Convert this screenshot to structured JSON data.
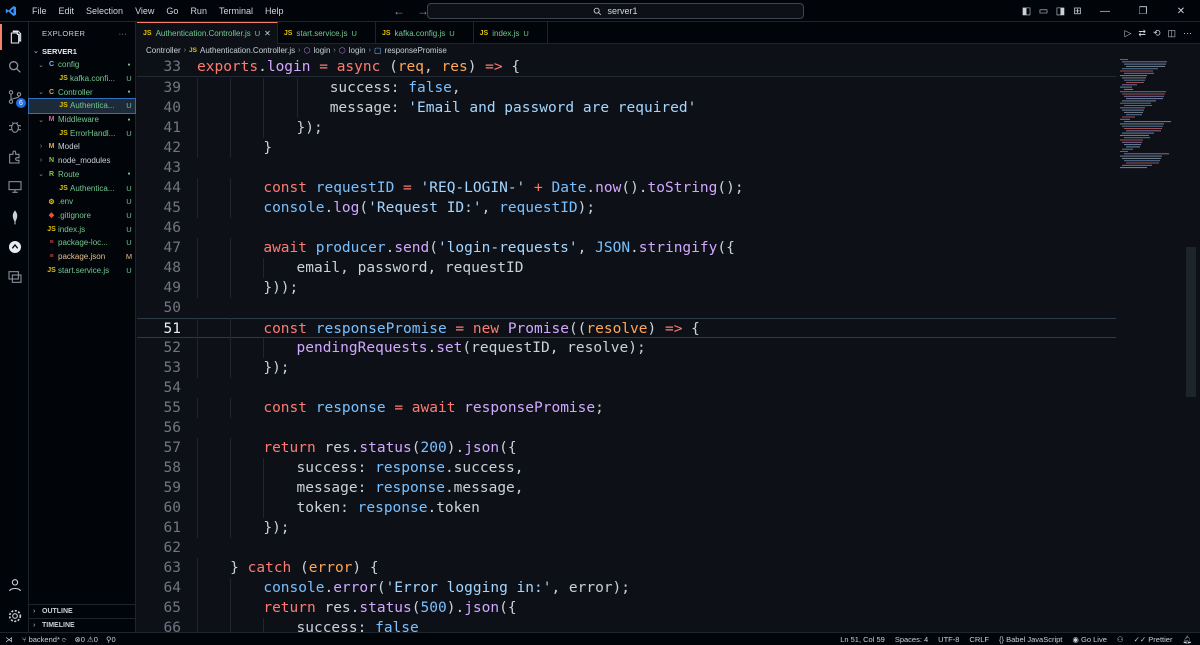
{
  "menu": [
    "File",
    "Edit",
    "Selection",
    "View",
    "Go",
    "Run",
    "Terminal",
    "Help"
  ],
  "search": {
    "label": "server1"
  },
  "sidebar": {
    "title": "EXPLORER",
    "more": "···",
    "root": "SERVER1",
    "items": [
      {
        "name": "config",
        "type": "folder",
        "open": true,
        "depth": 1,
        "icon": "C",
        "icon_color": "#7fb5ff",
        "status": "●",
        "status_color": "#73c991",
        "name_color": "#73c991"
      },
      {
        "name": "kafka.confi...",
        "type": "file",
        "depth": 2,
        "icon": "JS",
        "icon_color": "#e3c200",
        "status": "U",
        "status_color": "#73c991",
        "name_color": "#73c991"
      },
      {
        "name": "Controller",
        "type": "folder",
        "open": true,
        "depth": 1,
        "icon": "C",
        "icon_color": "#e8a34d",
        "status": "●",
        "status_color": "#73c991",
        "name_color": "#73c991"
      },
      {
        "name": "Authentica...",
        "type": "file",
        "depth": 2,
        "icon": "JS",
        "icon_color": "#e3c200",
        "status": "U",
        "status_color": "#73c991",
        "name_color": "#73c991",
        "selected": true
      },
      {
        "name": "Middleware",
        "type": "folder",
        "open": true,
        "depth": 1,
        "icon": "M",
        "icon_color": "#e55a9b",
        "status": "●",
        "status_color": "#73c991",
        "name_color": "#73c991"
      },
      {
        "name": "ErrorHandl...",
        "type": "file",
        "depth": 2,
        "icon": "JS",
        "icon_color": "#e3c200",
        "status": "U",
        "status_color": "#73c991",
        "name_color": "#73c991"
      },
      {
        "name": "Model",
        "type": "folder",
        "open": false,
        "depth": 1,
        "icon": "M",
        "icon_color": "#e8a34d",
        "status": "",
        "status_color": "#73c991",
        "name_color": "#c9d1d9"
      },
      {
        "name": "node_modules",
        "type": "folder",
        "open": false,
        "depth": 1,
        "icon": "N",
        "icon_color": "#8bc34a",
        "status": "",
        "status_color": "#73c991",
        "name_color": "#c9d1d9"
      },
      {
        "name": "Route",
        "type": "folder",
        "open": true,
        "depth": 1,
        "icon": "R",
        "icon_color": "#8bc34a",
        "status": "●",
        "status_color": "#73c991",
        "name_color": "#73c991"
      },
      {
        "name": "Authentica...",
        "type": "file",
        "depth": 2,
        "icon": "JS",
        "icon_color": "#e3c200",
        "status": "U",
        "status_color": "#73c991",
        "name_color": "#73c991"
      },
      {
        "name": ".env",
        "type": "file",
        "depth": 1,
        "icon": "⚙",
        "icon_color": "#e3c200",
        "status": "U",
        "status_color": "#73c991",
        "name_color": "#73c991"
      },
      {
        "name": ".gitignore",
        "type": "file",
        "depth": 1,
        "icon": "◆",
        "icon_color": "#f05133",
        "status": "U",
        "status_color": "#73c991",
        "name_color": "#73c991"
      },
      {
        "name": "index.js",
        "type": "file",
        "depth": 1,
        "icon": "JS",
        "icon_color": "#e3c200",
        "status": "U",
        "status_color": "#73c991",
        "name_color": "#73c991"
      },
      {
        "name": "package-loc...",
        "type": "file",
        "depth": 1,
        "icon": "≡",
        "icon_color": "#e5534b",
        "status": "U",
        "status_color": "#73c991",
        "name_color": "#73c991"
      },
      {
        "name": "package.json",
        "type": "file",
        "depth": 1,
        "icon": "≡",
        "icon_color": "#e5534b",
        "status": "M",
        "status_color": "#e2c08d",
        "name_color": "#e2c08d"
      },
      {
        "name": "start.service.js",
        "type": "file",
        "depth": 1,
        "icon": "JS",
        "icon_color": "#e3c200",
        "status": "U",
        "status_color": "#73c991",
        "name_color": "#73c991"
      }
    ],
    "outline": "OUTLINE",
    "timeline": "TIMELINE"
  },
  "tabs": [
    {
      "label": "Authentication.Controller.js",
      "mark": "U",
      "active": true,
      "close": "✕"
    },
    {
      "label": "start.service.js",
      "mark": "U",
      "active": false
    },
    {
      "label": "kafka.config.js",
      "mark": "U",
      "active": false
    },
    {
      "label": "index.js",
      "mark": "U",
      "active": false
    }
  ],
  "breadcrumb": [
    "Controller",
    "Authentication.Controller.js",
    "login",
    "login",
    "responsePromise"
  ],
  "editor": {
    "current_line": 51,
    "sticky_line": 33,
    "lines": [
      {
        "n": 33,
        "indent": 0,
        "t": [
          [
            "kw",
            "exports"
          ],
          [
            "pl",
            "."
          ],
          [
            "fn",
            "login"
          ],
          [
            "pl",
            " "
          ],
          [
            "kw",
            "="
          ],
          [
            "pl",
            " "
          ],
          [
            "kw",
            "async"
          ],
          [
            "pl",
            " ("
          ],
          [
            "var",
            "req"
          ],
          [
            "pl",
            ", "
          ],
          [
            "var",
            "res"
          ],
          [
            "pl",
            ") "
          ],
          [
            "kw",
            "=>"
          ],
          [
            "pl",
            " {"
          ]
        ]
      },
      {
        "n": 39,
        "indent": 4,
        "t": [
          [
            "pl",
            "success: "
          ],
          [
            "con",
            "false"
          ],
          [
            "pl",
            ","
          ]
        ]
      },
      {
        "n": 40,
        "indent": 4,
        "t": [
          [
            "pl",
            "message: "
          ],
          [
            "str",
            "'Email and password are required'"
          ]
        ]
      },
      {
        "n": 41,
        "indent": 3,
        "t": [
          [
            "pl",
            "});"
          ]
        ]
      },
      {
        "n": 42,
        "indent": 2,
        "t": [
          [
            "pl",
            "}"
          ]
        ]
      },
      {
        "n": 43,
        "indent": 0,
        "t": []
      },
      {
        "n": 44,
        "indent": 2,
        "t": [
          [
            "kw",
            "const"
          ],
          [
            "pl",
            " "
          ],
          [
            "con",
            "requestID"
          ],
          [
            "pl",
            " "
          ],
          [
            "kw",
            "="
          ],
          [
            "pl",
            " "
          ],
          [
            "str",
            "'REQ-LOGIN-'"
          ],
          [
            "pl",
            " "
          ],
          [
            "kw",
            "+"
          ],
          [
            "pl",
            " "
          ],
          [
            "con",
            "Date"
          ],
          [
            "pl",
            "."
          ],
          [
            "fn",
            "now"
          ],
          [
            "pl",
            "()."
          ],
          [
            "fn",
            "toString"
          ],
          [
            "pl",
            "();"
          ]
        ]
      },
      {
        "n": 45,
        "indent": 2,
        "t": [
          [
            "con",
            "console"
          ],
          [
            "pl",
            "."
          ],
          [
            "fn",
            "log"
          ],
          [
            "pl",
            "("
          ],
          [
            "str",
            "'Request ID:'"
          ],
          [
            "pl",
            ", "
          ],
          [
            "con",
            "requestID"
          ],
          [
            "pl",
            ");"
          ]
        ]
      },
      {
        "n": 46,
        "indent": 0,
        "t": []
      },
      {
        "n": 47,
        "indent": 2,
        "t": [
          [
            "kw",
            "await"
          ],
          [
            "pl",
            " "
          ],
          [
            "con",
            "producer"
          ],
          [
            "pl",
            "."
          ],
          [
            "fn",
            "send"
          ],
          [
            "pl",
            "("
          ],
          [
            "str",
            "'login-requests'"
          ],
          [
            "pl",
            ", "
          ],
          [
            "con",
            "JSON"
          ],
          [
            "pl",
            "."
          ],
          [
            "fn",
            "stringify"
          ],
          [
            "pl",
            "({"
          ]
        ]
      },
      {
        "n": 48,
        "indent": 3,
        "t": [
          [
            "pl",
            "email, password, requestID"
          ]
        ]
      },
      {
        "n": 49,
        "indent": 2,
        "t": [
          [
            "pl",
            "}));"
          ]
        ]
      },
      {
        "n": 50,
        "indent": 0,
        "t": []
      },
      {
        "n": 51,
        "indent": 2,
        "t": [
          [
            "kw",
            "const"
          ],
          [
            "pl",
            " "
          ],
          [
            "con",
            "responsePromise"
          ],
          [
            "pl",
            " "
          ],
          [
            "kw",
            "="
          ],
          [
            "pl",
            " "
          ],
          [
            "kw",
            "new"
          ],
          [
            "pl",
            " "
          ],
          [
            "fn",
            "Promise"
          ],
          [
            "pl",
            "(("
          ],
          [
            "var",
            "resolve"
          ],
          [
            "pl",
            ") "
          ],
          [
            "kw",
            "=>"
          ],
          [
            "pl",
            " {"
          ]
        ]
      },
      {
        "n": 52,
        "indent": 3,
        "t": [
          [
            "fn",
            "pendingRequests"
          ],
          [
            "pl",
            "."
          ],
          [
            "fn",
            "set"
          ],
          [
            "pl",
            "(requestID, resolve);"
          ]
        ]
      },
      {
        "n": 53,
        "indent": 2,
        "t": [
          [
            "pl",
            "});"
          ]
        ]
      },
      {
        "n": 54,
        "indent": 0,
        "t": []
      },
      {
        "n": 55,
        "indent": 2,
        "t": [
          [
            "kw",
            "const"
          ],
          [
            "pl",
            " "
          ],
          [
            "con",
            "response"
          ],
          [
            "pl",
            " "
          ],
          [
            "kw",
            "="
          ],
          [
            "pl",
            " "
          ],
          [
            "kw",
            "await"
          ],
          [
            "pl",
            " "
          ],
          [
            "fn",
            "responsePromise"
          ],
          [
            "pl",
            ";"
          ]
        ]
      },
      {
        "n": 56,
        "indent": 0,
        "t": []
      },
      {
        "n": 57,
        "indent": 2,
        "t": [
          [
            "kw",
            "return"
          ],
          [
            "pl",
            " res."
          ],
          [
            "fn",
            "status"
          ],
          [
            "pl",
            "("
          ],
          [
            "num",
            "200"
          ],
          [
            "pl",
            ")."
          ],
          [
            "fn",
            "json"
          ],
          [
            "pl",
            "({"
          ]
        ]
      },
      {
        "n": 58,
        "indent": 3,
        "t": [
          [
            "pl",
            "success: "
          ],
          [
            "con",
            "response"
          ],
          [
            "pl",
            ".success,"
          ]
        ]
      },
      {
        "n": 59,
        "indent": 3,
        "t": [
          [
            "pl",
            "message: "
          ],
          [
            "con",
            "response"
          ],
          [
            "pl",
            ".message,"
          ]
        ]
      },
      {
        "n": 60,
        "indent": 3,
        "t": [
          [
            "pl",
            "token: "
          ],
          [
            "con",
            "response"
          ],
          [
            "pl",
            ".token"
          ]
        ]
      },
      {
        "n": 61,
        "indent": 2,
        "t": [
          [
            "pl",
            "});"
          ]
        ]
      },
      {
        "n": 62,
        "indent": 0,
        "t": []
      },
      {
        "n": 63,
        "indent": 1,
        "t": [
          [
            "pl",
            "} "
          ],
          [
            "kw",
            "catch"
          ],
          [
            "pl",
            " ("
          ],
          [
            "var",
            "error"
          ],
          [
            "pl",
            ") {"
          ]
        ]
      },
      {
        "n": 64,
        "indent": 2,
        "t": [
          [
            "con",
            "console"
          ],
          [
            "pl",
            "."
          ],
          [
            "fn",
            "error"
          ],
          [
            "pl",
            "("
          ],
          [
            "str",
            "'Error logging in:'"
          ],
          [
            "pl",
            ", error);"
          ]
        ]
      },
      {
        "n": 65,
        "indent": 2,
        "t": [
          [
            "kw",
            "return"
          ],
          [
            "pl",
            " res."
          ],
          [
            "fn",
            "status"
          ],
          [
            "pl",
            "("
          ],
          [
            "num",
            "500"
          ],
          [
            "pl",
            ")."
          ],
          [
            "fn",
            "json"
          ],
          [
            "pl",
            "({"
          ]
        ]
      },
      {
        "n": 66,
        "indent": 3,
        "t": [
          [
            "pl",
            "success: "
          ],
          [
            "con",
            "false"
          ]
        ]
      }
    ]
  },
  "statusbar": {
    "branch": "backend*",
    "sync": "⟳",
    "errors": "0",
    "warnings": "0",
    "ports": "0",
    "position": "Ln 51, Col 59",
    "spaces": "Spaces: 4",
    "encoding": "UTF-8",
    "eol": "CRLF",
    "language": "Babel JavaScript",
    "golive": "Go Live",
    "prettier": "Prettier"
  },
  "colors": {
    "accent": "#f78166",
    "untracked": "#73c991",
    "modified": "#e2c08d",
    "js_badge": "#e3c200"
  }
}
